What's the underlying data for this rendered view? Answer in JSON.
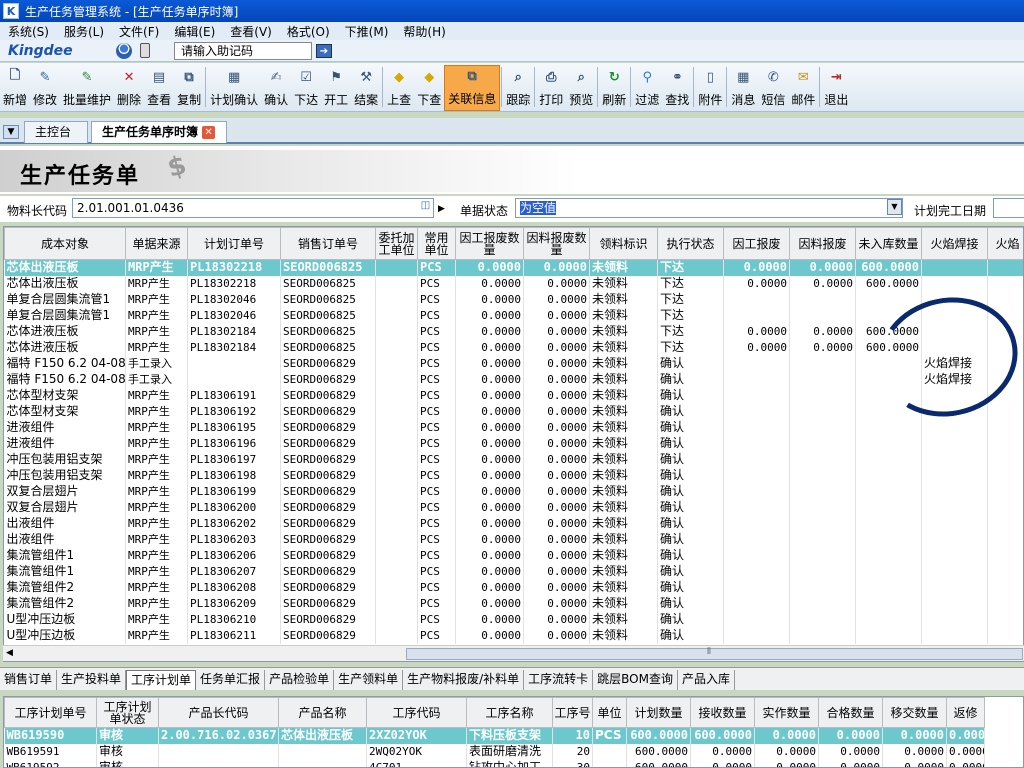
{
  "window": {
    "title": "生产任务管理系统 - [生产任务单序时簿]"
  },
  "menu": [
    "系统(S)",
    "服务(L)",
    "文件(F)",
    "编辑(E)",
    "查看(V)",
    "格式(O)",
    "下推(M)",
    "帮助(H)"
  ],
  "brand": {
    "logo": "Kingdee",
    "help_input": "请输入助记码"
  },
  "toolbar": [
    {
      "label": "新增",
      "icon": "new-doc-icon"
    },
    {
      "label": "修改",
      "icon": "edit-icon"
    },
    {
      "label": "批量维护",
      "icon": "batch-edit-icon"
    },
    {
      "label": "删除",
      "icon": "delete-icon"
    },
    {
      "label": "查看",
      "icon": "view-icon"
    },
    {
      "label": "复制",
      "icon": "copy-icon"
    },
    {
      "sep": true
    },
    {
      "label": "计划确认",
      "icon": "plan-confirm-icon"
    },
    {
      "label": "确认",
      "icon": "confirm-icon"
    },
    {
      "label": "下达",
      "icon": "issue-icon"
    },
    {
      "label": "开工",
      "icon": "start-icon"
    },
    {
      "label": "结案",
      "icon": "close-case-icon"
    },
    {
      "sep": true
    },
    {
      "label": "上查",
      "icon": "trace-up-icon"
    },
    {
      "label": "下查",
      "icon": "trace-down-icon"
    },
    {
      "label": "关联信息",
      "icon": "related-info-icon",
      "active": true
    },
    {
      "sep": true
    },
    {
      "label": "跟踪",
      "icon": "track-icon"
    },
    {
      "sep": true
    },
    {
      "label": "打印",
      "icon": "print-icon"
    },
    {
      "label": "预览",
      "icon": "preview-icon"
    },
    {
      "sep": true
    },
    {
      "label": "刷新",
      "icon": "refresh-icon"
    },
    {
      "sep": true
    },
    {
      "label": "过滤",
      "icon": "filter-icon"
    },
    {
      "label": "查找",
      "icon": "find-icon"
    },
    {
      "sep": true
    },
    {
      "label": "附件",
      "icon": "attachment-icon"
    },
    {
      "sep": true
    },
    {
      "label": "消息",
      "icon": "message-icon"
    },
    {
      "label": "短信",
      "icon": "sms-icon"
    },
    {
      "label": "邮件",
      "icon": "mail-icon"
    },
    {
      "sep": true
    },
    {
      "label": "退出",
      "icon": "exit-icon"
    }
  ],
  "tabs": [
    {
      "label": "主控台"
    },
    {
      "label": "生产任务单序时簿",
      "selected": true
    }
  ],
  "banner": {
    "title": "生产任务单"
  },
  "filter": {
    "code_label": "物料长代码",
    "code_value": "2.01.001.01.0436",
    "status_label": "单据状态",
    "status_value": "为空值",
    "date_label": "计划完工日期"
  },
  "grid": {
    "columns": [
      "成本对象",
      "单据来源",
      "计划订单号",
      "销售订单号",
      "委托加工单位",
      "常用单位",
      "因工报废数量",
      "因料报废数量",
      "领料标识",
      "执行状态",
      "因工报废",
      "因料报废",
      "未入库数量",
      "火焰焊接",
      "火焰"
    ],
    "rows": [
      [
        "芯体出液压板",
        "MRP产生",
        "PL18302218",
        "SEORD006825",
        "",
        "PCS",
        "0.0000",
        "0.0000",
        "未领料",
        "下达",
        "0.0000",
        "0.0000",
        "600.0000",
        "",
        ""
      ],
      [
        "芯体出液压板",
        "MRP产生",
        "PL18302218",
        "SEORD006825",
        "",
        "PCS",
        "0.0000",
        "0.0000",
        "未领料",
        "下达",
        "0.0000",
        "0.0000",
        "600.0000",
        "",
        ""
      ],
      [
        "单复合层圆集流管1",
        "MRP产生",
        "PL18302046",
        "SEORD006825",
        "",
        "PCS",
        "0.0000",
        "0.0000",
        "未领料",
        "下达",
        "",
        "",
        "",
        "",
        ""
      ],
      [
        "单复合层圆集流管1",
        "MRP产生",
        "PL18302046",
        "SEORD006825",
        "",
        "PCS",
        "0.0000",
        "0.0000",
        "未领料",
        "下达",
        "",
        "",
        "",
        "",
        ""
      ],
      [
        "芯体进液压板",
        "MRP产生",
        "PL18302184",
        "SEORD006825",
        "",
        "PCS",
        "0.0000",
        "0.0000",
        "未领料",
        "下达",
        "0.0000",
        "0.0000",
        "600.0000",
        "",
        ""
      ],
      [
        "芯体进液压板",
        "MRP产生",
        "PL18302184",
        "SEORD006825",
        "",
        "PCS",
        "0.0000",
        "0.0000",
        "未领料",
        "下达",
        "0.0000",
        "0.0000",
        "600.0000",
        "",
        ""
      ],
      [
        "福特 F150 6.2 04-08",
        "手工录入",
        "",
        "SEORD006829",
        "",
        "PCS",
        "0.0000",
        "0.0000",
        "未领料",
        "确认",
        "",
        "",
        "",
        "火焰焊接",
        ""
      ],
      [
        "福特 F150 6.2 04-08",
        "手工录入",
        "",
        "SEORD006829",
        "",
        "PCS",
        "0.0000",
        "0.0000",
        "未领料",
        "确认",
        "",
        "",
        "",
        "火焰焊接",
        ""
      ],
      [
        "芯体型材支架",
        "MRP产生",
        "PL18306191",
        "SEORD006829",
        "",
        "PCS",
        "0.0000",
        "0.0000",
        "未领料",
        "确认",
        "",
        "",
        "",
        "",
        ""
      ],
      [
        "芯体型材支架",
        "MRP产生",
        "PL18306192",
        "SEORD006829",
        "",
        "PCS",
        "0.0000",
        "0.0000",
        "未领料",
        "确认",
        "",
        "",
        "",
        "",
        ""
      ],
      [
        "进液组件",
        "MRP产生",
        "PL18306195",
        "SEORD006829",
        "",
        "PCS",
        "0.0000",
        "0.0000",
        "未领料",
        "确认",
        "",
        "",
        "",
        "",
        ""
      ],
      [
        "进液组件",
        "MRP产生",
        "PL18306196",
        "SEORD006829",
        "",
        "PCS",
        "0.0000",
        "0.0000",
        "未领料",
        "确认",
        "",
        "",
        "",
        "",
        ""
      ],
      [
        "冲压包装用铝支架",
        "MRP产生",
        "PL18306197",
        "SEORD006829",
        "",
        "PCS",
        "0.0000",
        "0.0000",
        "未领料",
        "确认",
        "",
        "",
        "",
        "",
        ""
      ],
      [
        "冲压包装用铝支架",
        "MRP产生",
        "PL18306198",
        "SEORD006829",
        "",
        "PCS",
        "0.0000",
        "0.0000",
        "未领料",
        "确认",
        "",
        "",
        "",
        "",
        ""
      ],
      [
        "双复合层翅片",
        "MRP产生",
        "PL18306199",
        "SEORD006829",
        "",
        "PCS",
        "0.0000",
        "0.0000",
        "未领料",
        "确认",
        "",
        "",
        "",
        "",
        ""
      ],
      [
        "双复合层翅片",
        "MRP产生",
        "PL18306200",
        "SEORD006829",
        "",
        "PCS",
        "0.0000",
        "0.0000",
        "未领料",
        "确认",
        "",
        "",
        "",
        "",
        ""
      ],
      [
        "出液组件",
        "MRP产生",
        "PL18306202",
        "SEORD006829",
        "",
        "PCS",
        "0.0000",
        "0.0000",
        "未领料",
        "确认",
        "",
        "",
        "",
        "",
        ""
      ],
      [
        "出液组件",
        "MRP产生",
        "PL18306203",
        "SEORD006829",
        "",
        "PCS",
        "0.0000",
        "0.0000",
        "未领料",
        "确认",
        "",
        "",
        "",
        "",
        ""
      ],
      [
        "集流管组件1",
        "MRP产生",
        "PL18306206",
        "SEORD006829",
        "",
        "PCS",
        "0.0000",
        "0.0000",
        "未领料",
        "确认",
        "",
        "",
        "",
        "",
        ""
      ],
      [
        "集流管组件1",
        "MRP产生",
        "PL18306207",
        "SEORD006829",
        "",
        "PCS",
        "0.0000",
        "0.0000",
        "未领料",
        "确认",
        "",
        "",
        "",
        "",
        ""
      ],
      [
        "集流管组件2",
        "MRP产生",
        "PL18306208",
        "SEORD006829",
        "",
        "PCS",
        "0.0000",
        "0.0000",
        "未领料",
        "确认",
        "",
        "",
        "",
        "",
        ""
      ],
      [
        "集流管组件2",
        "MRP产生",
        "PL18306209",
        "SEORD006829",
        "",
        "PCS",
        "0.0000",
        "0.0000",
        "未领料",
        "确认",
        "",
        "",
        "",
        "",
        ""
      ],
      [
        "U型冲压边板",
        "MRP产生",
        "PL18306210",
        "SEORD006829",
        "",
        "PCS",
        "0.0000",
        "0.0000",
        "未领料",
        "确认",
        "",
        "",
        "",
        "",
        ""
      ],
      [
        "U型冲压边板",
        "MRP产生",
        "PL18306211",
        "SEORD006829",
        "",
        "PCS",
        "0.0000",
        "0.0000",
        "未领料",
        "确认",
        "",
        "",
        "",
        "",
        ""
      ]
    ]
  },
  "bottom_tabs": [
    "销售订单",
    "生产投料单",
    "工序计划单",
    "任务单汇报",
    "产品检验单",
    "生产领料单",
    "生产物料报废/补料单",
    "工序流转卡",
    "跳层BOM查询",
    "产品入库"
  ],
  "bottom_selected": 2,
  "grid2": {
    "columns": [
      "工序计划单号",
      "工序计划单状态",
      "产品长代码",
      "产品名称",
      "工序代码",
      "工序名称",
      "工序号",
      "单位",
      "计划数量",
      "接收数量",
      "实作数量",
      "合格数量",
      "移交数量",
      "返修"
    ],
    "rows": [
      [
        "WB619590",
        "审核",
        "2.00.716.02.0367",
        "芯体出液压板",
        "2XZ02YOK",
        "下料压板支架",
        "10",
        "PCS",
        "600.0000",
        "600.0000",
        "0.0000",
        "0.0000",
        "0.0000",
        "0.0000"
      ],
      [
        "WB619591",
        "审核",
        "",
        "",
        "2WQ02YOK",
        "表面研磨清洗",
        "20",
        "",
        "600.0000",
        "0.0000",
        "0.0000",
        "0.0000",
        "0.0000",
        "0.0000"
      ],
      [
        "WB619592",
        "审核",
        "",
        "",
        "4C701",
        "钻攻中心加工",
        "30",
        "",
        "600.0000",
        "0.0000",
        "0.0000",
        "0.0000",
        "0.0000",
        "0.0000"
      ]
    ]
  }
}
